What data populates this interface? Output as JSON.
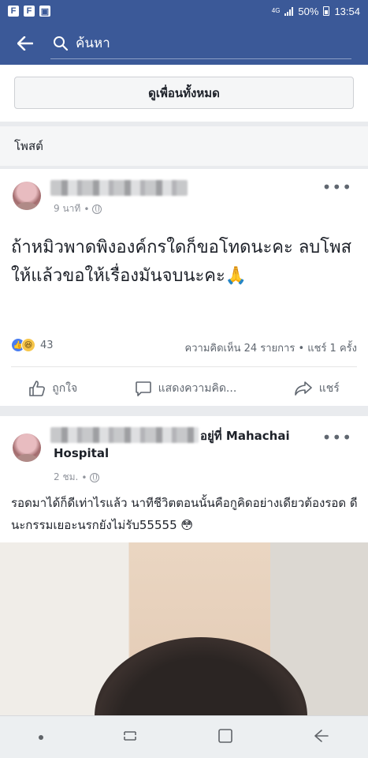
{
  "status_bar": {
    "network": "4G",
    "battery": "50%",
    "time": "13:54",
    "app_icons": [
      "F",
      "F",
      "▣"
    ]
  },
  "search": {
    "placeholder": "ค้นหา"
  },
  "friends": {
    "see_all_label": "ดูเพื่อนทั้งหมด"
  },
  "section": {
    "posts_label": "โพสต์"
  },
  "posts": [
    {
      "time": "9 นาที",
      "text": "ถ้าหมิวพาดพิงองค์กรใดก็ขอโทดนะคะ ลบโพสให้แล้วขอให้เรื่องมันจบนะคะ🙏",
      "reaction_count": "43",
      "summary": "ความคิดเห็น 24 รายการ • แชร์ 1 ครั้ง",
      "actions": [
        "ถูกใจ",
        "แสดงความคิด...",
        "แชร์"
      ]
    },
    {
      "location": "อยู่ที่ Mahachai Hospital",
      "time": "2 ชม.",
      "text": "รอดมาได้ก็ดีเท่าไรแล้ว นาทีชีวิตตอนนั้นคือกูคิดอย่างเดียวต้องรอด ดีนะกรรมเยอะนรกยังไม่รับ55555 😳"
    }
  ],
  "colors": {
    "brand": "#3b5998",
    "bg": "#e9ebee",
    "text": "#1d2129",
    "muted": "#90949c"
  }
}
